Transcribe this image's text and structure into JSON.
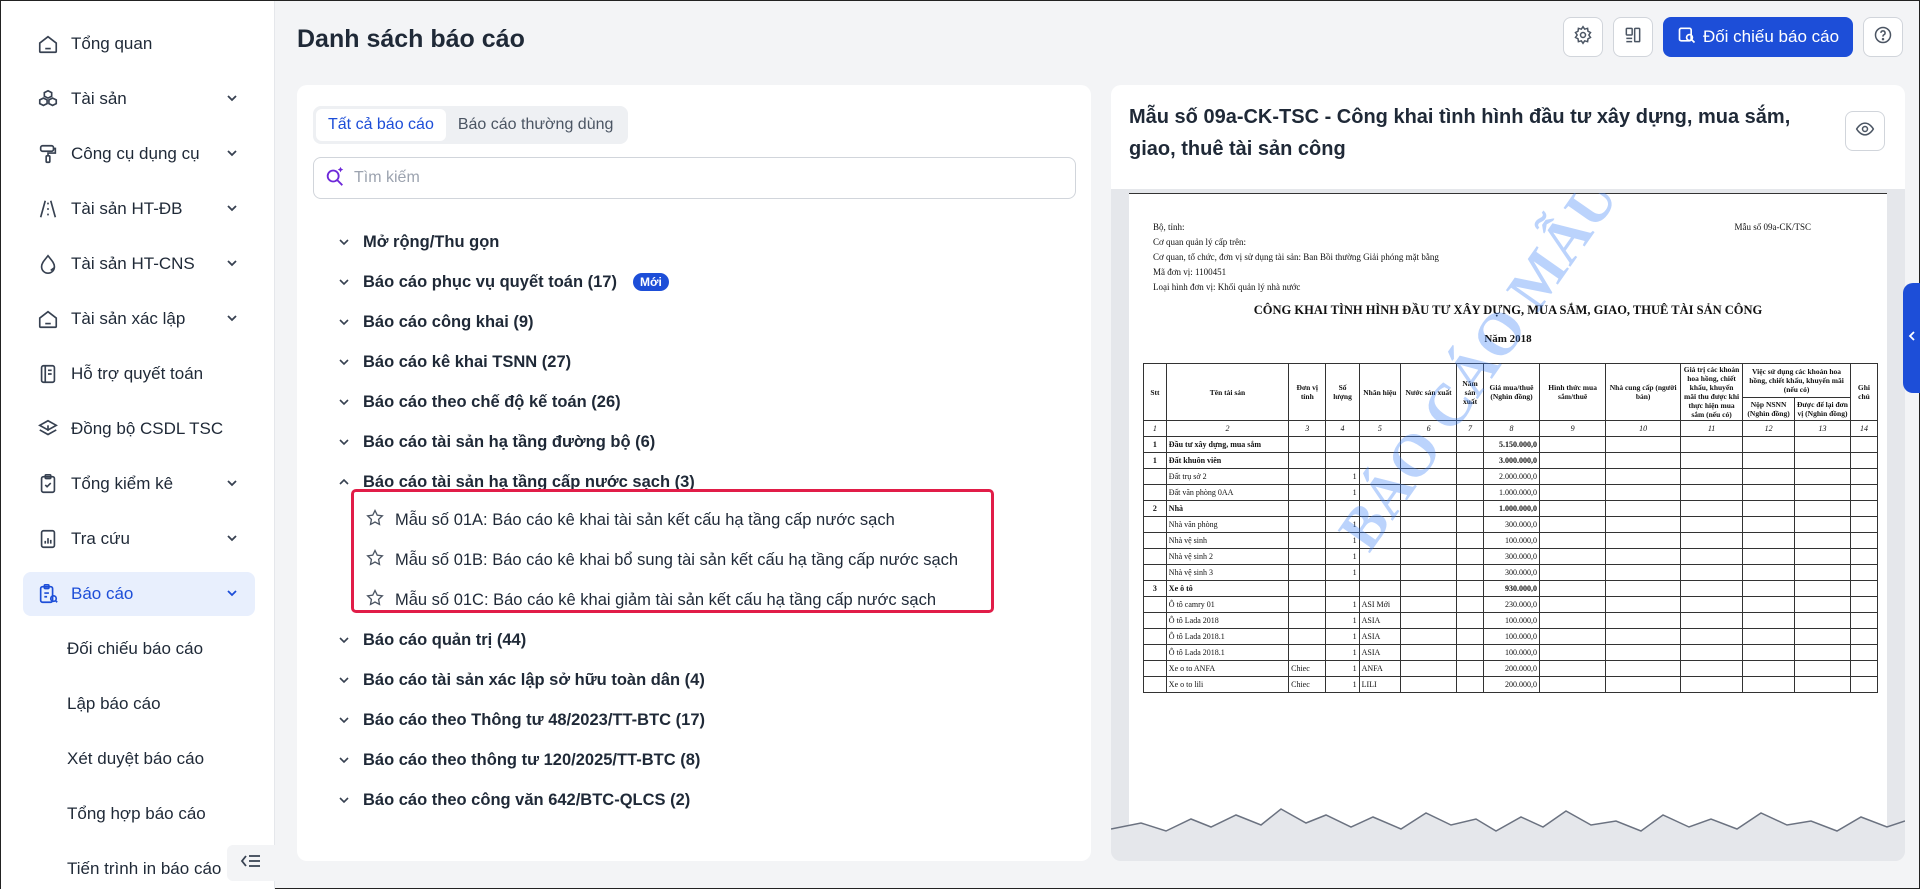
{
  "sidebar": {
    "items": [
      {
        "label": "Tổng quan",
        "icon": "home-icon"
      },
      {
        "label": "Tài sản",
        "icon": "cubes-icon"
      },
      {
        "label": "Công cụ dụng cụ",
        "icon": "paint-roller-icon"
      },
      {
        "label": "Tài sản HT-ĐB",
        "icon": "road-icon"
      },
      {
        "label": "Tài sản HT-CNS",
        "icon": "water-drop-icon"
      },
      {
        "label": "Tài sản xác lập",
        "icon": "home-icon"
      },
      {
        "label": "Hỗ trợ quyết toán",
        "icon": "ledger-icon"
      },
      {
        "label": "Đồng bộ CSDL TSC",
        "icon": "layers-icon"
      },
      {
        "label": "Tổng kiểm kê",
        "icon": "clipboard-icon"
      },
      {
        "label": "Tra cứu",
        "icon": "chart-doc-icon"
      },
      {
        "label": "Báo cáo",
        "icon": "report-icon"
      }
    ],
    "sub_items": [
      "Đối chiếu báo cáo",
      "Lập báo cáo",
      "Xét duyệt báo cáo",
      "Tổng hợp báo cáo",
      "Tiến trình in báo cáo"
    ]
  },
  "header": {
    "title": "Danh sách báo cáo",
    "compare_button": "Đối chiếu báo cáo"
  },
  "left_panel": {
    "tabs": [
      "Tất cả báo cáo",
      "Báo cáo thường dùng"
    ],
    "search_placeholder": "Tìm kiếm",
    "tree": [
      {
        "label": "Mở rộng/Thu gọn"
      },
      {
        "label": "Báo cáo phục vụ quyết toán (17)",
        "badge": "Mới"
      },
      {
        "label": "Báo cáo công khai (9)"
      },
      {
        "label": "Báo cáo kê khai TSNN (27)"
      },
      {
        "label": "Báo cáo theo chế độ kế toán (26)"
      },
      {
        "label": "Báo cáo tài sản hạ tầng đường bộ (6)"
      },
      {
        "label": "Báo cáo tài sản hạ tầng cấp nước sạch (3)",
        "expanded": true
      },
      {
        "label": "Báo cáo quản trị (44)"
      },
      {
        "label": "Báo cáo tài sản xác lập sở hữu toàn dân (4)"
      },
      {
        "label": "Báo cáo theo Thông tư 48/2023/TT-BTC (17)"
      },
      {
        "label": "Báo cáo theo thông tư 120/2025/TT-BTC (8)"
      },
      {
        "label": "Báo cáo theo công văn 642/BTC-QLCS (2)"
      }
    ],
    "leaves": [
      "Mẫu số 01A: Báo cáo kê khai tài sản kết cấu hạ tầng cấp nước sạch",
      "Mẫu số 01B: Báo cáo kê khai bổ sung tài sản kết cấu hạ tầng cấp nước sạch",
      "Mẫu số 01C: Báo cáo kê khai giảm tài sản kết cấu hạ tầng cấp nước sạch"
    ]
  },
  "preview": {
    "title": "Mẫu số 09a-CK-TSC - Công khai tình hình đầu tư xây dựng, mua sắm, giao, thuê tài sản công",
    "paper": {
      "form_no": "Mẫu số 09a-CK/TSC",
      "meta": [
        "Bộ, tỉnh:",
        "Cơ quan quản lý cấp trên:",
        "Cơ quan, tổ chức, đơn vị sử dụng tài sản: Ban Bồi thường Giải phóng mặt bằng",
        "Mã đơn vị: 1100451",
        "Loại hình đơn vị: Khối quản lý nhà nước"
      ],
      "title": "CÔNG KHAI TÌNH HÌNH ĐẦU TƯ XÂY DỰNG, MUA SẮM, GIAO, THUÊ TÀI SẢN CÔNG",
      "year": "Năm 2018",
      "watermark": "BÁO CÁO MẪU",
      "headers": [
        "Stt",
        "Tên tài sản",
        "Đơn vị tính",
        "Số lượng",
        "Nhãn hiệu",
        "Nước sản xuất",
        "Năm sản xuất",
        "Giá mua/thuê (Nghìn đồng)",
        "Hình thức mua sắm/thuê",
        "Nhà cung cấp (người bán)",
        "Giá trị các khoản hoa hồng, chiết khấu, khuyến mãi thu được khi thực hiện mua sắm (nếu có)",
        "Nộp NSNN (Nghìn đồng)",
        "Được để lại đơn vị (Nghìn đồng)",
        "Ghi chú"
      ],
      "group_header": "Việc sử dụng các khoản hoa hồng, chiết khấu, khuyến mãi (nếu có)",
      "col_numbers": [
        "1",
        "2",
        "3",
        "4",
        "5",
        "6",
        "7",
        "8",
        "9",
        "10",
        "11",
        "12",
        "13",
        "14"
      ],
      "rows": [
        {
          "stt": "1",
          "name": "Đầu tư xây dựng, mua sắm",
          "unit": "",
          "qty": "",
          "brand": "",
          "price": "5.150.000,0",
          "bold": true
        },
        {
          "stt": "1",
          "name": "Đất khuôn viên",
          "unit": "",
          "qty": "",
          "brand": "",
          "price": "3.000.000,0",
          "bold": true
        },
        {
          "stt": "",
          "name": "Đất trụ sở 2",
          "unit": "",
          "qty": "1",
          "brand": "",
          "price": "2.000.000,0"
        },
        {
          "stt": "",
          "name": "Đất văn phòng 0AA",
          "unit": "",
          "qty": "1",
          "brand": "",
          "price": "1.000.000,0"
        },
        {
          "stt": "2",
          "name": "Nhà",
          "unit": "",
          "qty": "",
          "brand": "",
          "price": "1.000.000,0",
          "bold": true
        },
        {
          "stt": "",
          "name": "Nhà văn phòng",
          "unit": "",
          "qty": "1",
          "brand": "",
          "price": "300.000,0"
        },
        {
          "stt": "",
          "name": "Nhà vệ sinh",
          "unit": "",
          "qty": "1",
          "brand": "",
          "price": "100.000,0"
        },
        {
          "stt": "",
          "name": "Nhà vệ sinh 2",
          "unit": "",
          "qty": "1",
          "brand": "",
          "price": "300.000,0"
        },
        {
          "stt": "",
          "name": "Nhà vệ sinh 3",
          "unit": "",
          "qty": "1",
          "brand": "",
          "price": "300.000,0"
        },
        {
          "stt": "3",
          "name": "Xe ô tô",
          "unit": "",
          "qty": "",
          "brand": "",
          "price": "930.000,0",
          "bold": true
        },
        {
          "stt": "",
          "name": "Ô tô camry 01",
          "unit": "",
          "qty": "1",
          "brand": "ASI Mới",
          "price": "230.000,0"
        },
        {
          "stt": "",
          "name": "Ô tô Lada 2018",
          "unit": "",
          "qty": "1",
          "brand": "ASIA",
          "price": "100.000,0"
        },
        {
          "stt": "",
          "name": "Ô tô Lada 2018.1",
          "unit": "",
          "qty": "1",
          "brand": "ASIA",
          "price": "100.000,0"
        },
        {
          "stt": "",
          "name": "Ô tô Lada 2018.1",
          "unit": "",
          "qty": "1",
          "brand": "ASIA",
          "price": "100.000,0"
        },
        {
          "stt": "",
          "name": "Xe o to ANFA",
          "unit": "Chiec",
          "qty": "1",
          "brand": "ANFA",
          "price": "200.000,0"
        },
        {
          "stt": "",
          "name": "Xe o to lili",
          "unit": "Chiec",
          "qty": "1",
          "brand": "LILI",
          "price": "200.000,0"
        }
      ]
    }
  },
  "colors": {
    "accent": "#1d4ed8",
    "highlight": "#e11d48",
    "active_bg": "#e8effd"
  }
}
